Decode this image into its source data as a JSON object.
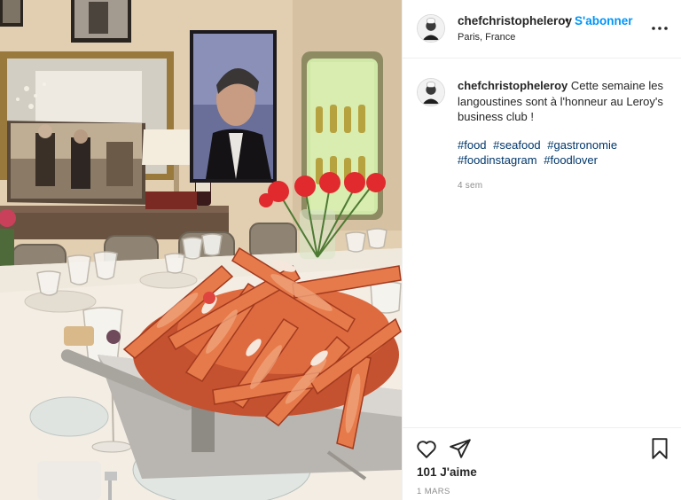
{
  "post": {
    "username": "chefchristopheleroy",
    "separator": "•",
    "follow_label": "S'abonner",
    "location": "Paris, France",
    "more_icon": "more-horizontal-icon"
  },
  "caption": {
    "username": "chefchristopheleroy",
    "text": "Cette semaine les langoustines sont à l'honneur au Leroy's business club !",
    "hashtags": [
      "#food",
      "#seafood",
      "#gastronomie",
      "#foodinstagram",
      "#foodlover"
    ],
    "age": "4 sem"
  },
  "footer": {
    "likes": "101 J'aime",
    "date": "1 MARS",
    "icons": [
      "heart-icon",
      "share-icon",
      "bookmark-icon"
    ]
  },
  "colors": {
    "link_blue": "#0095f6",
    "hashtag": "#00376b",
    "muted": "#8e8e8e",
    "border": "#efefef"
  }
}
